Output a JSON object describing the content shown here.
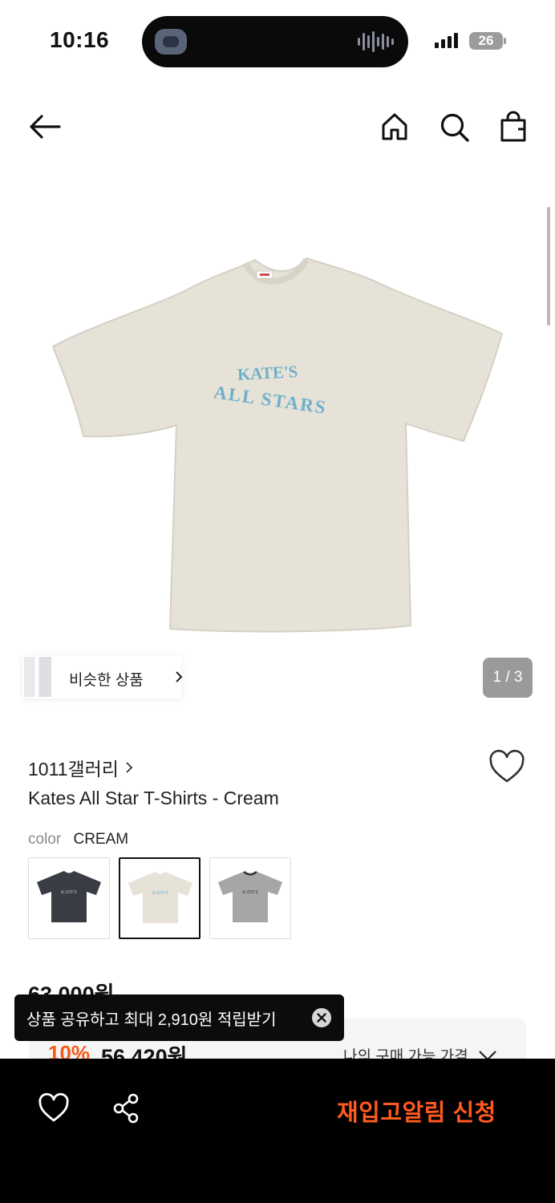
{
  "status_bar": {
    "time": "10:16",
    "battery": "26"
  },
  "header": {
    "back_icon": "arrow-left-icon",
    "home_icon": "home-icon",
    "search_icon": "search-icon",
    "cart_icon": "shopping-bag-icon"
  },
  "gallery": {
    "print_text_line1": "KATE'S",
    "print_text_line2": "ALL STARS",
    "similar_label": "비슷한 상품",
    "page_indicator": "1 / 3"
  },
  "product": {
    "brand": "1011갤러리",
    "name": "Kates All Star T-Shirts - Cream",
    "color_label": "color",
    "color_value": "CREAM",
    "swatches": [
      {
        "name": "charcoal",
        "color": "#3a3c44",
        "selected": false
      },
      {
        "name": "cream",
        "color": "#e6e2d8",
        "selected": true
      },
      {
        "name": "gray",
        "color": "#a6a6a8",
        "selected": false
      }
    ],
    "original_price": "63,000원",
    "discount_rate": "10%",
    "sale_price": "56,420원",
    "my_price_label": "나의 구매 가능 가격"
  },
  "toast": {
    "text": "상품 공유하고 최대 2,910원 적립받기"
  },
  "bottom_bar": {
    "wish_icon": "heart-icon",
    "share_icon": "share-icon",
    "restock_label": "재입고알림 신청"
  },
  "colors": {
    "accent": "#ff5a1f",
    "discount": "#f35a1a",
    "print_blue": "#6fb0c9",
    "shirt_cream": "#e6e2d8"
  }
}
